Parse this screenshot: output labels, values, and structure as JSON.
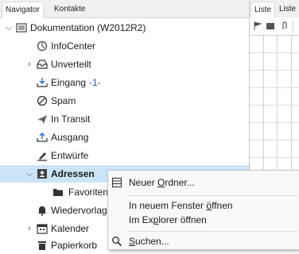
{
  "nav_tabs": [
    "Navigator",
    "Kontakte"
  ],
  "list_tabs": [
    "Liste",
    "Liste"
  ],
  "tree": {
    "root": {
      "label": "Dokumentation (W2012R2)",
      "icon": "mailbox-icon"
    },
    "items": [
      {
        "label": "InfoCenter",
        "icon": "infocenter-icon"
      },
      {
        "label": "Unverteilt",
        "icon": "inbox-tray-icon"
      },
      {
        "label": "Eingang",
        "count": "-1-",
        "icon": "inbox-icon"
      },
      {
        "label": "Spam",
        "icon": "spam-icon"
      },
      {
        "label": "In Transit",
        "icon": "send-icon"
      },
      {
        "label": "Ausgang",
        "icon": "outbox-icon"
      },
      {
        "label": "Entwürfe",
        "icon": "drafts-icon"
      },
      {
        "label": "Adressen",
        "icon": "contacts-icon"
      },
      {
        "label": "Favoriten",
        "icon": "folder-icon"
      },
      {
        "label": "Wiedervorlag",
        "icon": "bell-icon"
      },
      {
        "label": "Kalender",
        "icon": "calendar-icon"
      },
      {
        "label": "Papierkorb",
        "icon": "trash-icon"
      }
    ]
  },
  "context_menu": {
    "new_folder": {
      "before": "Neuer ",
      "underlined": "O",
      "after": "rdner..."
    },
    "open_new_window": {
      "before": "In neuem Fenster ",
      "underlined": "ö",
      "after": "ffnen"
    },
    "open_explorer": {
      "before": "Im Ex",
      "underlined": "p",
      "after": "lorer öffnen"
    },
    "search": {
      "before": "",
      "underlined": "S",
      "after": "uchen..."
    }
  },
  "colors": {
    "selection": "#cce4f7",
    "count": "#1a4fd6",
    "accent": "#2b6fc2"
  }
}
